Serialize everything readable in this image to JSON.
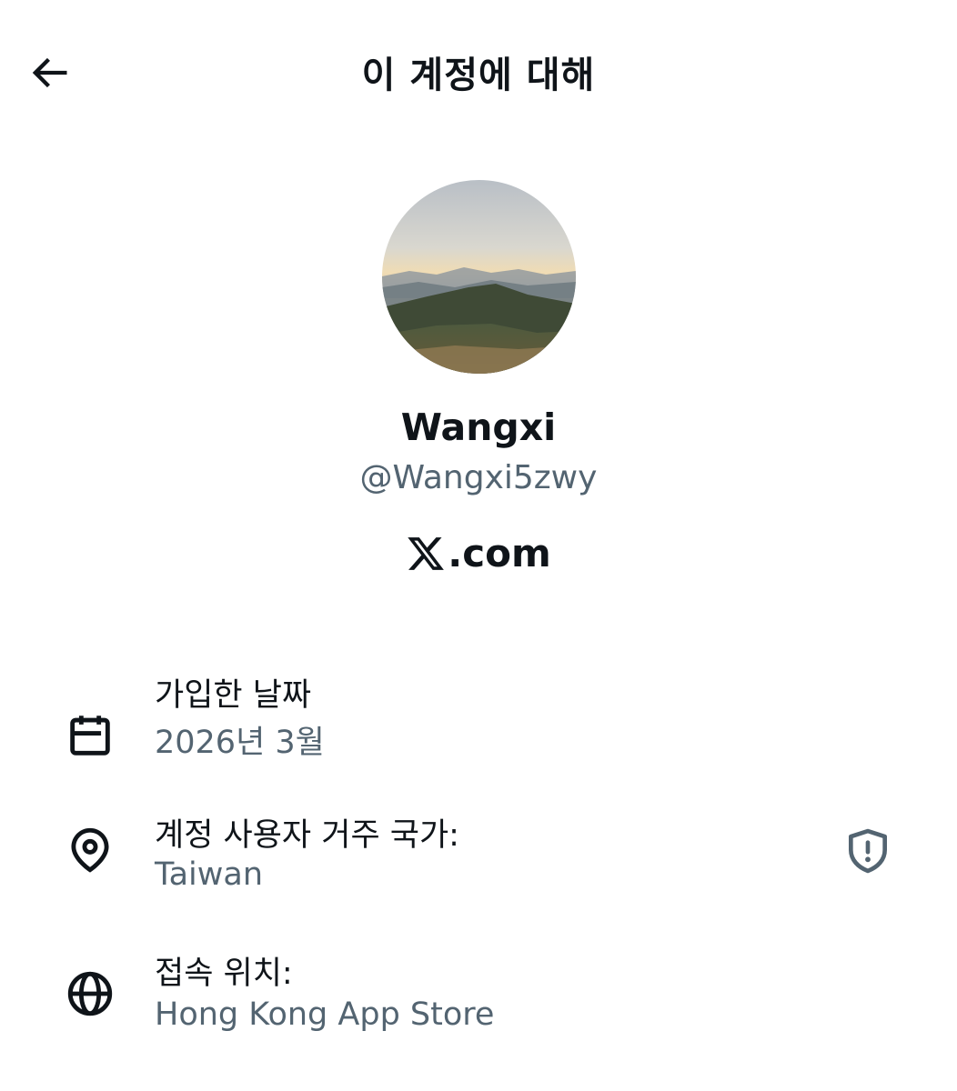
{
  "header": {
    "title": "이 계정에 대해",
    "back_icon": "arrow-left-icon"
  },
  "profile": {
    "display_name": "Wangxi",
    "handle": "@Wangxi5zwy",
    "brand_suffix": ".com",
    "brand_icon": "x-logo-icon"
  },
  "info": {
    "joined": {
      "icon": "calendar-icon",
      "label": "가입한 날짜",
      "value": "2026년 3월"
    },
    "country": {
      "icon": "location-pin-icon",
      "label": "계정 사용자 거주 국가:",
      "value": "Taiwan",
      "action_icon": "shield-alert-icon"
    },
    "connected_via": {
      "icon": "globe-icon",
      "label": "접속 위치:",
      "value": "Hong Kong App Store"
    }
  },
  "colors": {
    "primary_text": "#0f1419",
    "secondary_text": "#536471",
    "background": "#ffffff"
  }
}
